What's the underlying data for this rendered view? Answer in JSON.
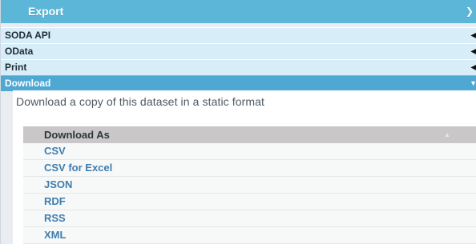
{
  "export": {
    "title": "Export",
    "arrow_icon": "chevron-right-icon"
  },
  "sections": [
    {
      "label": "SODA API",
      "icon": "caret-left-icon",
      "active": false
    },
    {
      "label": "OData",
      "icon": "caret-left-icon",
      "active": false
    },
    {
      "label": "Print",
      "icon": "caret-left-icon",
      "active": false
    },
    {
      "label": "Download",
      "icon": "caret-down-icon",
      "active": true
    }
  ],
  "download": {
    "description": "Download a copy of this dataset in a static format",
    "list_header": "Download As",
    "sort_icon": "sort-up-icon",
    "formats": [
      "CSV",
      "CSV for Excel",
      "JSON",
      "RDF",
      "RSS",
      "XML"
    ]
  },
  "colors": {
    "header": "#5bb6d8",
    "section": "#d7eef8",
    "active_section": "#4ea8d2",
    "link": "#3f7eb0"
  }
}
